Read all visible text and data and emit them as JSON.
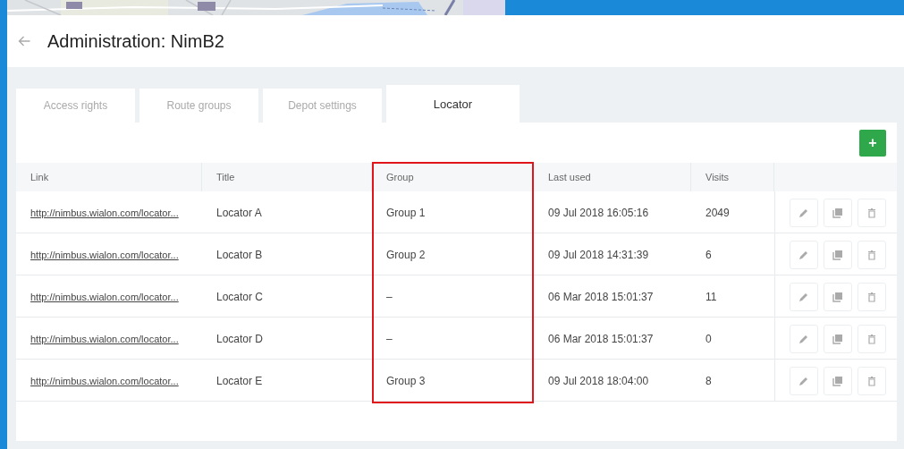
{
  "header": {
    "title": "Administration: NimB2"
  },
  "tabs": [
    {
      "label": "Access rights",
      "selected": false
    },
    {
      "label": "Route groups",
      "selected": false
    },
    {
      "label": "Depot settings",
      "selected": false
    },
    {
      "label": "Locator",
      "selected": true
    }
  ],
  "add_button": {
    "label": "+"
  },
  "table": {
    "columns": [
      {
        "label": "Link",
        "highlighted": false
      },
      {
        "label": "Title",
        "highlighted": false
      },
      {
        "label": "Group",
        "highlighted": true
      },
      {
        "label": "Last used",
        "highlighted": false
      },
      {
        "label": "Visits",
        "highlighted": false
      }
    ],
    "rows": [
      {
        "link": "http://nimbus.wialon.com/locator...",
        "title": "Locator A",
        "group": "Group 1",
        "last_used": "09 Jul 2018 16:05:16",
        "visits": "2049"
      },
      {
        "link": "http://nimbus.wialon.com/locator...",
        "title": "Locator B",
        "group": "Group 2",
        "last_used": "09 Jul 2018 14:31:39",
        "visits": "6"
      },
      {
        "link": "http://nimbus.wialon.com/locator...",
        "title": "Locator C",
        "group": "–",
        "last_used": "06 Mar 2018 15:01:37",
        "visits": "11"
      },
      {
        "link": "http://nimbus.wialon.com/locator...",
        "title": "Locator D",
        "group": "–",
        "last_used": "06 Mar 2018 15:01:37",
        "visits": "0"
      },
      {
        "link": "http://nimbus.wialon.com/locator...",
        "title": "Locator E",
        "group": "Group 3",
        "last_used": "09 Jul 2018 18:04:00",
        "visits": "8"
      }
    ]
  }
}
